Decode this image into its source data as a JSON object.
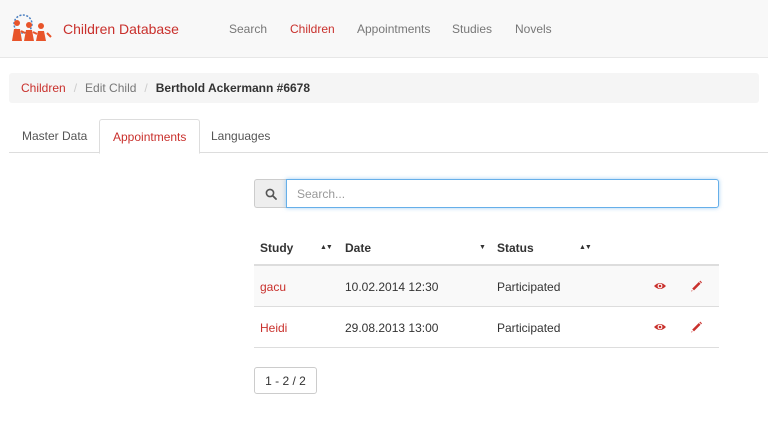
{
  "app": {
    "title": "Children Database"
  },
  "nav": {
    "items": [
      {
        "label": "Search",
        "active": false
      },
      {
        "label": "Children",
        "active": true
      },
      {
        "label": "Appointments",
        "active": false
      },
      {
        "label": "Studies",
        "active": false
      },
      {
        "label": "Novels",
        "active": false
      }
    ]
  },
  "breadcrumb": {
    "items": [
      "Children",
      "Edit Child",
      "Berthold Ackermann #6678"
    ],
    "separator": "/"
  },
  "tabs": {
    "items": [
      {
        "label": "Master Data",
        "active": false
      },
      {
        "label": "Appointments",
        "active": true
      },
      {
        "label": "Languages",
        "active": false
      }
    ]
  },
  "search": {
    "placeholder": "Search...",
    "value": "",
    "icon": "search-icon"
  },
  "table": {
    "columns": [
      "Study",
      "Date",
      "Status"
    ],
    "sort_indicators": [
      "▲▼",
      "▼",
      "▲▼"
    ],
    "rows": [
      {
        "study": "gacu",
        "date": "10.02.2014 12:30",
        "status": "Participated"
      },
      {
        "study": "Heidi",
        "date": "29.08.2013 13:00",
        "status": "Participated"
      }
    ],
    "row_actions": [
      "eye-icon",
      "pencil-icon"
    ]
  },
  "pagination": {
    "label": "1 - 2 / 2"
  },
  "colors": {
    "accent": "#c9302c",
    "navbar_bg": "#f8f8f8",
    "focus_border": "#66afe9",
    "striped_row": "#f9f9f9"
  }
}
